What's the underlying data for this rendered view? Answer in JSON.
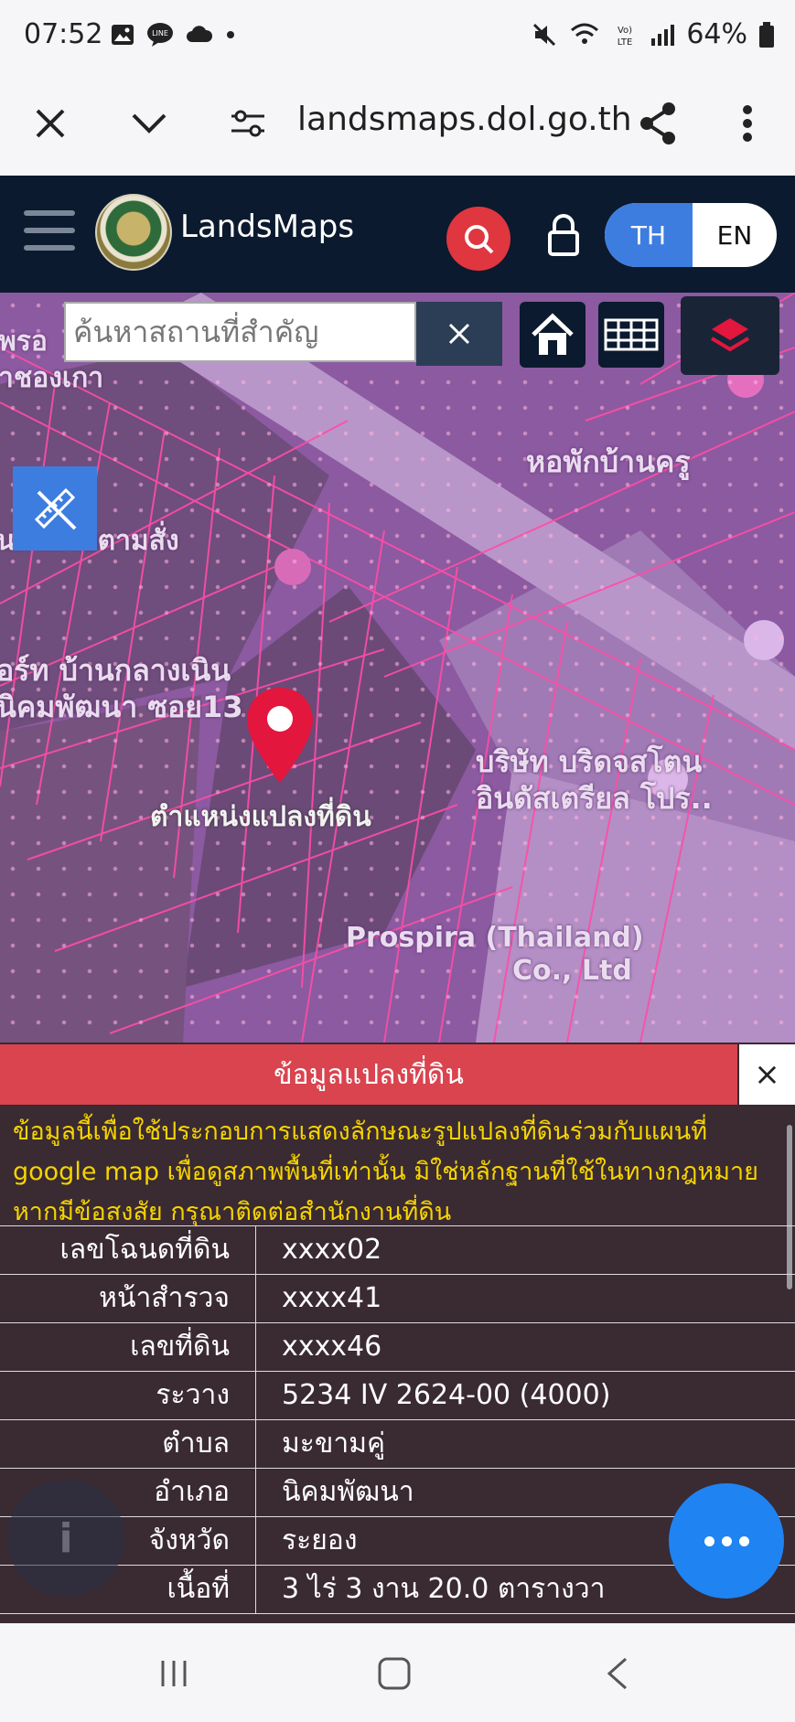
{
  "status": {
    "time": "07:52",
    "battery": "64%",
    "volte": "VoLTE"
  },
  "browser": {
    "url": "landsmaps.dol.go.th"
  },
  "app": {
    "brand": "LandsMaps",
    "lang_th": "TH",
    "lang_en": "EN"
  },
  "map": {
    "search_placeholder": "ค้นหาสถานที่สำคัญ",
    "marker_label": "ตำแหน่งแปลงที่ดิน",
    "labels": {
      "hostel": "หอพักบ้านครู",
      "apartment_line1": "อร์ท บ้านกลางเนิน",
      "apartment_line2": "นิคมพัฒนา ซอย13",
      "company_line1": "บริษัท บริดจสโตน",
      "company_line2": "อินดัสเตรียล โปร..",
      "prospira_line1": "Prospira (Thailand)",
      "prospira_line2": "Co., Ltd",
      "top_left_1": "พรอ",
      "top_left_2": "าชองเกา",
      "left_mid": "นสำหรับตามสั่ง"
    }
  },
  "panel": {
    "title": "ข้อมูลแปลงที่ดิน",
    "close": "×",
    "disclaimer": [
      "ข้อมูลนี้เพื่อใช้ประกอบการแสดงลักษณะรูปแปลงที่ดินร่วมกับแผนที่",
      "google map เพื่อดูสภาพพื้นที่เท่านั้น มิใช่หลักฐานที่ใช้ในทางกฎหมาย",
      "หากมีข้อสงสัย กรุณาติดต่อสำนักงานที่ดิน"
    ],
    "rows": [
      {
        "key": "เลขโฉนดที่ดิน",
        "value": "xxxx02"
      },
      {
        "key": "หน้าสำรวจ",
        "value": "xxxx41"
      },
      {
        "key": "เลขที่ดิน",
        "value": "xxxx46"
      },
      {
        "key": "ระวาง",
        "value": "5234 IV 2624-00 (4000)"
      },
      {
        "key": "ตำบล",
        "value": "มะขามคู่"
      },
      {
        "key": "อำเภอ",
        "value": "นิคมพัฒนา"
      },
      {
        "key": "จังหวัด",
        "value": "ระยอง"
      },
      {
        "key": "เนื้อที่",
        "value": "3 ไร่ 3 งาน 20.0 ตารางวา"
      }
    ]
  },
  "colors": {
    "header": "#0b1a2e",
    "accent_red": "#d9444f",
    "accent_blue": "#3d7de0",
    "fab": "#1f83f2",
    "disclaimer": "#f5d400"
  }
}
